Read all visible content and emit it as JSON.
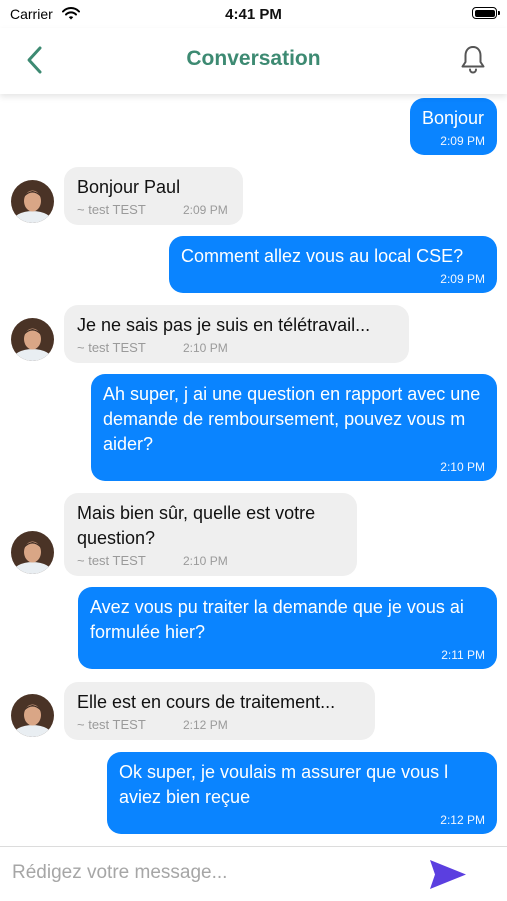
{
  "status_bar": {
    "carrier": "Carrier",
    "time": "4:41 PM"
  },
  "header": {
    "title": "Conversation"
  },
  "colors": {
    "accent": "#3d8a72",
    "outgoing_bubble": "#0a84ff",
    "incoming_bubble": "#efefef",
    "send_icon": "#5b3fe0"
  },
  "icons": {
    "back": "chevron-left-icon",
    "notifications": "bell-icon",
    "send": "send-icon"
  },
  "messages": [
    {
      "direction": "out",
      "text": "Bonjour",
      "time": "2:09 PM"
    },
    {
      "direction": "in",
      "text": "Bonjour Paul",
      "author": "~ test TEST",
      "time": "2:09 PM"
    },
    {
      "direction": "out",
      "text": "Comment allez vous au local CSE?",
      "time": "2:09 PM"
    },
    {
      "direction": "in",
      "text": "Je ne sais pas je suis en télétravail...",
      "author": "~ test TEST",
      "time": "2:10 PM"
    },
    {
      "direction": "out",
      "text": "Ah super, j ai une question en rapport avec une demande de remboursement, pouvez vous m aider?",
      "time": "2:10 PM"
    },
    {
      "direction": "in",
      "text": "Mais bien sûr, quelle est votre question?",
      "author": "~ test TEST",
      "time": "2:10 PM"
    },
    {
      "direction": "out",
      "text": "Avez vous pu traiter la demande que je vous ai formulée hier?",
      "time": "2:11 PM"
    },
    {
      "direction": "in",
      "text": "Elle est en cours de traitement...",
      "author": "~ test TEST",
      "time": "2:12 PM"
    },
    {
      "direction": "out",
      "text": "Ok super, je voulais m assurer que vous l aviez bien reçue",
      "time": "2:12 PM"
    }
  ],
  "composer": {
    "placeholder": "Rédigez votre message..."
  }
}
